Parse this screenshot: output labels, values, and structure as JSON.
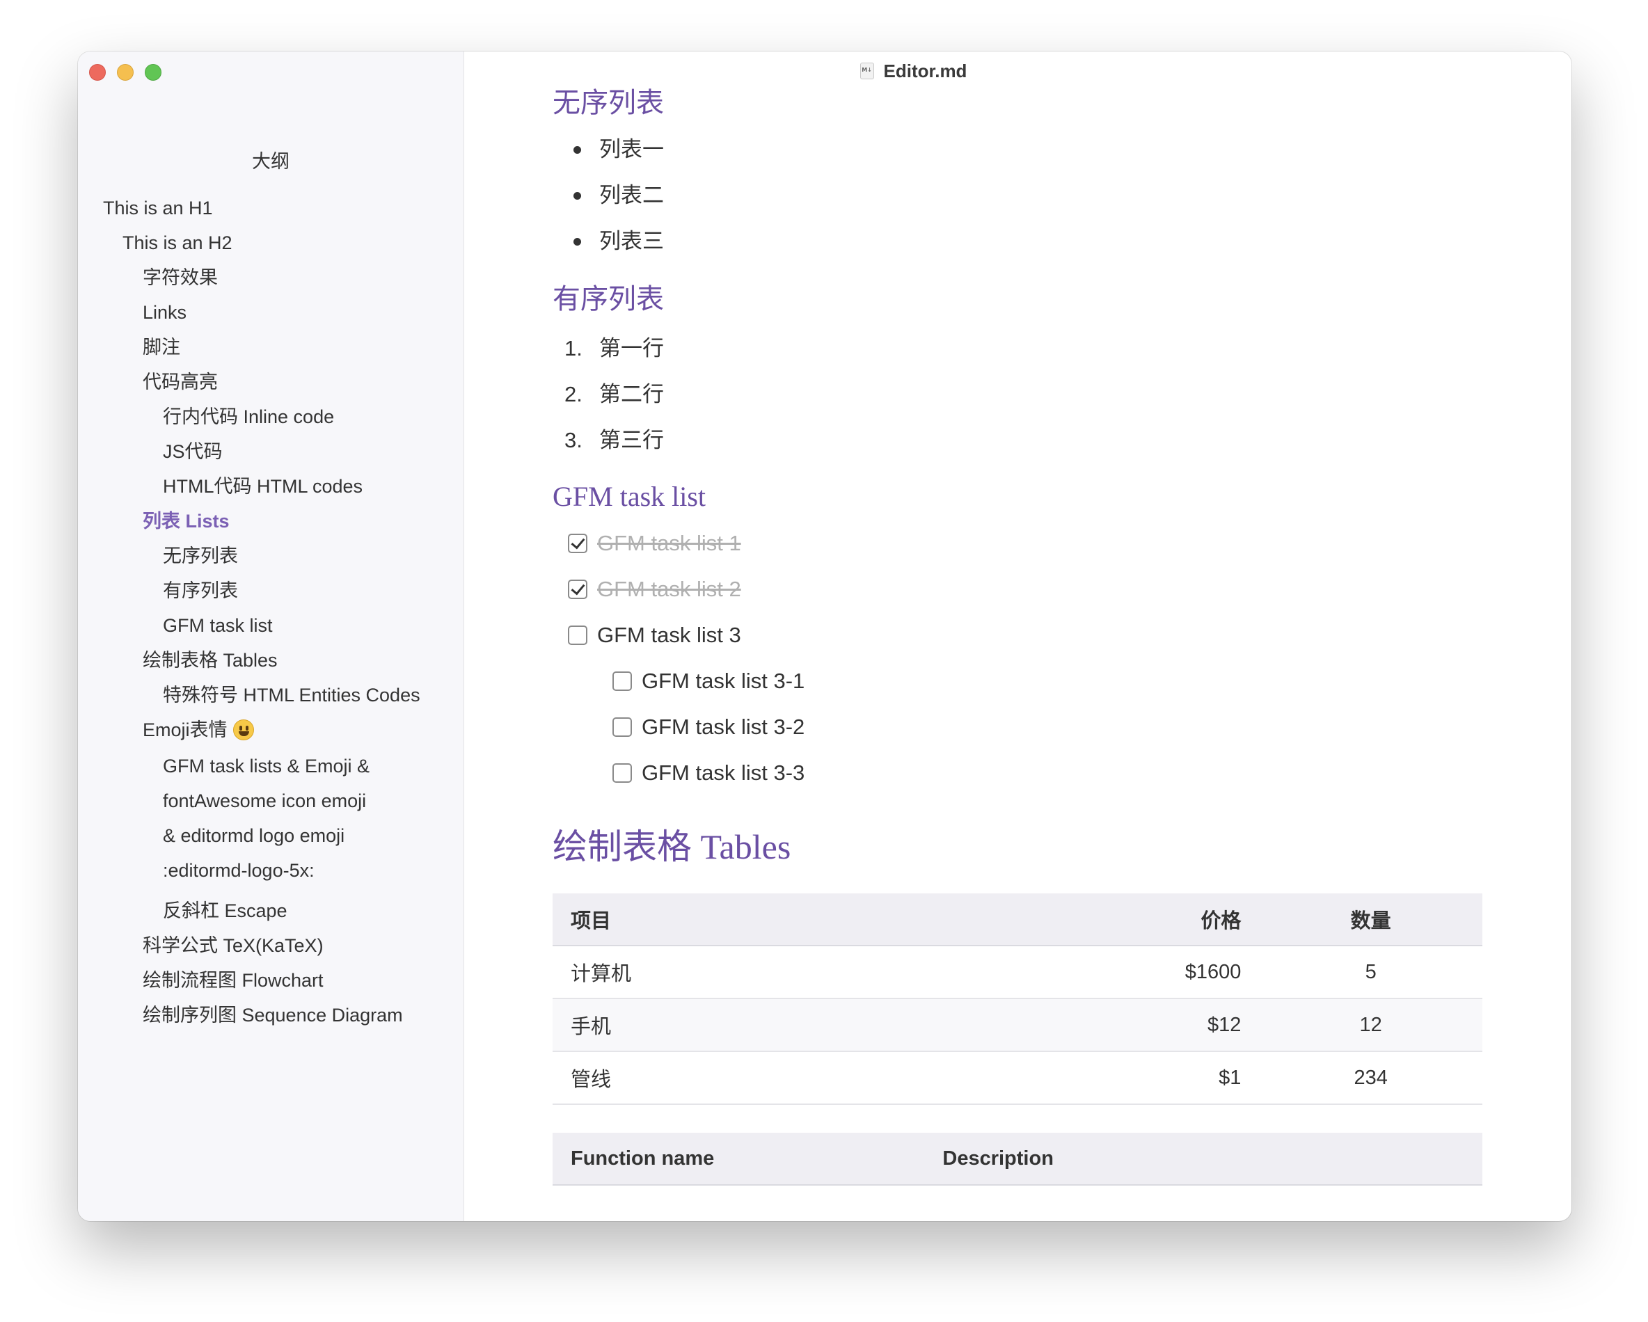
{
  "window": {
    "title": "Editor.md",
    "file_icon": "markdown-file-icon"
  },
  "sidebar": {
    "title": "大纲",
    "items": [
      {
        "label": "This is an H1",
        "level": 1
      },
      {
        "label": "This is an H2",
        "level": 2
      },
      {
        "label": "字符效果",
        "level": 3
      },
      {
        "label": "Links",
        "level": 3
      },
      {
        "label": "脚注",
        "level": 3
      },
      {
        "label": "代码高亮",
        "level": 3
      },
      {
        "label": "行内代码 Inline code",
        "level": 4
      },
      {
        "label": "JS代码",
        "level": 4
      },
      {
        "label": "HTML代码 HTML codes",
        "level": 4
      },
      {
        "label": "列表 Lists",
        "level": 3,
        "active": true
      },
      {
        "label": "无序列表",
        "level": 4
      },
      {
        "label": "有序列表",
        "level": 4
      },
      {
        "label": "GFM task list",
        "level": 4
      },
      {
        "label": "绘制表格 Tables",
        "level": 3
      },
      {
        "label": "特殊符号 HTML Entities Codes",
        "level": 4
      },
      {
        "label": "Emoji表情",
        "level": 3,
        "icon": "smiley-emoji-icon"
      },
      {
        "label": "GFM task lists & Emoji & fontAwesome icon emoji & editormd logo emoji :editormd-logo-5x:",
        "level": 4
      },
      {
        "label": "反斜杠 Escape",
        "level": 4
      },
      {
        "label": "科学公式 TeX(KaTeX)",
        "level": 3
      },
      {
        "label": "绘制流程图 Flowchart",
        "level": 3
      },
      {
        "label": "绘制序列图 Sequence Diagram",
        "level": 3
      }
    ]
  },
  "content": {
    "unordered": {
      "heading": "无序列表",
      "items": [
        "列表一",
        "列表二",
        "列表三"
      ]
    },
    "ordered": {
      "heading": "有序列表",
      "items": [
        "第一行",
        "第二行",
        "第三行"
      ],
      "numbers": [
        "1.",
        "2.",
        "3."
      ]
    },
    "tasks": {
      "heading": "GFM task list",
      "items": [
        {
          "label": "GFM task list 1",
          "checked": true
        },
        {
          "label": "GFM task list 2",
          "checked": true
        },
        {
          "label": "GFM task list 3",
          "checked": false
        },
        {
          "label": "GFM task list 3-1",
          "checked": false,
          "sub": true
        },
        {
          "label": "GFM task list 3-2",
          "checked": false,
          "sub": true
        },
        {
          "label": "GFM task list 3-3",
          "checked": false,
          "sub": true
        }
      ]
    },
    "tables": {
      "heading": "绘制表格 Tables",
      "table1": {
        "headers": [
          "项目",
          "价格",
          "数量"
        ],
        "rows": [
          [
            "计算机",
            "$1600",
            "5"
          ],
          [
            "手机",
            "$12",
            "12"
          ],
          [
            "管线",
            "$1",
            "234"
          ]
        ]
      },
      "table2": {
        "headers": [
          "Function name",
          "Description"
        ]
      }
    }
  },
  "colors": {
    "accent": "#6a4fa3",
    "sidebar_active": "#7b60b4",
    "sidebar_bg": "#f7f7fa"
  }
}
